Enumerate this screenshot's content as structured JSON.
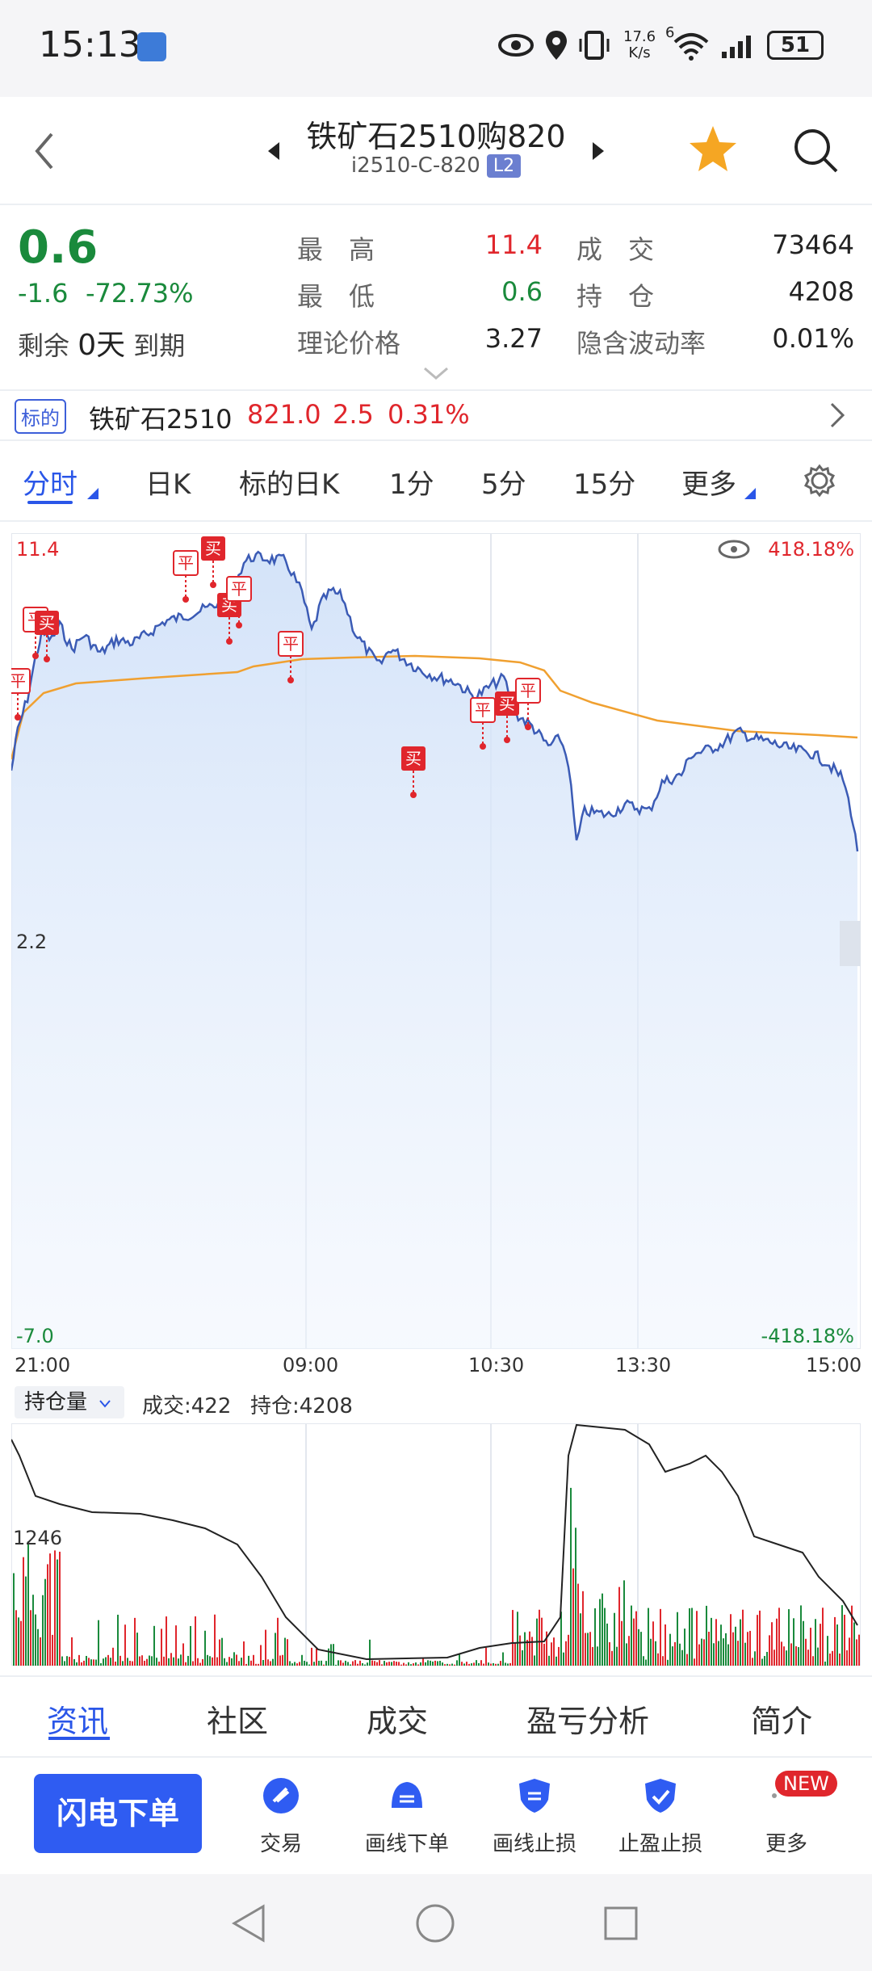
{
  "status": {
    "time": "15:13",
    "net_speed_top": "17.6",
    "net_speed_unit": "K/s",
    "signal_sup": "6",
    "battery": "51"
  },
  "nav": {
    "title": "铁矿石2510购820",
    "code": "i2510-C-820",
    "badge": "L2"
  },
  "quote": {
    "price": "0.6",
    "change": "-1.6",
    "change_pct": "-72.73%",
    "remain_label_1": "剩余",
    "remain_days": "0天",
    "remain_label_2": "到期",
    "high_label": "最　高",
    "high": "11.4",
    "low_label": "最　低",
    "low": "0.6",
    "theory_label": "理论价格",
    "theory": "3.27",
    "volume_label": "成　交",
    "volume": "73464",
    "oi_label": "持　仓",
    "oi": "4208",
    "iv_label": "隐含波动率",
    "iv": "0.01%"
  },
  "underlying": {
    "tag": "标的",
    "name": "铁矿石2510",
    "price": "821.0",
    "change": "2.5",
    "change_pct": "0.31%"
  },
  "tabs": [
    "分时",
    "日K",
    "标的日K",
    "1分",
    "5分",
    "15分",
    "更多"
  ],
  "chart": {
    "y_top": "11.4",
    "y_mid": "2.2",
    "y_bottom": "-7.0",
    "pct_top": "418.18%",
    "pct_bottom": "-418.18%",
    "x_labels": [
      "21:00",
      "09:00",
      "10:30",
      "13:30",
      "15:00"
    ],
    "markers": [
      {
        "label": "平",
        "type": "open"
      },
      {
        "label": "平",
        "type": "open"
      },
      {
        "label": "买",
        "type": "fill"
      },
      {
        "label": "平",
        "type": "open"
      },
      {
        "label": "买",
        "type": "fill"
      },
      {
        "label": "买",
        "type": "fill"
      },
      {
        "label": "平",
        "type": "open"
      },
      {
        "label": "平",
        "type": "open"
      },
      {
        "label": "买",
        "type": "fill"
      },
      {
        "label": "平",
        "type": "open"
      },
      {
        "label": "买",
        "type": "fill"
      },
      {
        "label": "平",
        "type": "open"
      }
    ]
  },
  "volume_panel": {
    "selector": "持仓量",
    "volume_text": "成交:422",
    "oi_text": "持仓:4208",
    "y_label": "1246"
  },
  "bottom_tabs": [
    "资讯",
    "社区",
    "成交",
    "盈亏分析",
    "简介"
  ],
  "toolbar": {
    "flash": "闪电下单",
    "items": [
      "交易",
      "画线下单",
      "画线止损",
      "止盈止损",
      "更多"
    ],
    "new_badge": "NEW"
  },
  "colors": {
    "accent": "#2f5cf2",
    "up": "#e0262c",
    "down": "#1a8a3c",
    "price_line": "#3b5bb5",
    "avg_line": "#f0a030"
  }
}
